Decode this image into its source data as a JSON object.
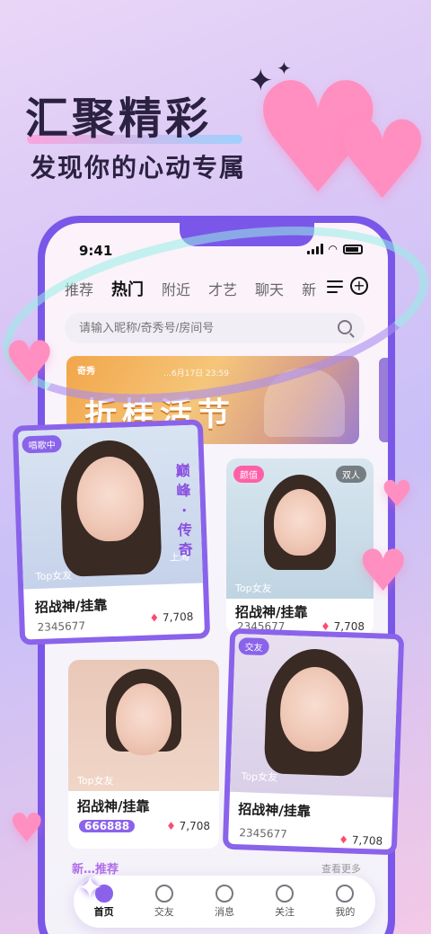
{
  "promo": {
    "title": "汇聚精彩",
    "subtitle": "发现你的心动专属"
  },
  "status_bar": {
    "time": "9:41"
  },
  "tabs": [
    {
      "label": "推荐",
      "active": false
    },
    {
      "label": "热门",
      "active": true
    },
    {
      "label": "附近",
      "active": false
    },
    {
      "label": "才艺",
      "active": false
    },
    {
      "label": "聊天",
      "active": false
    },
    {
      "label": "新",
      "active": false
    }
  ],
  "search": {
    "placeholder": "请输入昵称/奇秀号/房间号"
  },
  "banner": {
    "logo": "奇秀",
    "date": "…6月17日 23:59",
    "title": "折桂活节"
  },
  "cards": [
    {
      "badge": "唱歌中",
      "tag_bottom": "Top女友",
      "location": "上海",
      "side_text": "巅峰·传奇",
      "name": "招战神/挂靠",
      "id": "2345677",
      "heat": "7,708"
    },
    {
      "badge": "颜值",
      "badge_right": "双人",
      "tag_bottom": "Top女友",
      "name": "招战神/挂靠",
      "id": "2345677",
      "heat": "7,708"
    },
    {
      "tag_bottom": "Top女友",
      "name": "招战神/挂靠",
      "id": "666888",
      "heat": "7,708"
    },
    {
      "badge": "交友",
      "tag_bottom": "Top女友",
      "name": "招战神/挂靠",
      "id": "2345677",
      "heat": "7,708"
    }
  ],
  "section": {
    "title": "新…推荐",
    "more": "查看更多"
  },
  "nav": [
    {
      "label": "首页",
      "icon": "home-icon",
      "active": true
    },
    {
      "label": "交友",
      "icon": "chat-bars-icon",
      "active": false
    },
    {
      "label": "消息",
      "icon": "message-icon",
      "active": false
    },
    {
      "label": "关注",
      "icon": "heart-icon",
      "active": false
    },
    {
      "label": "我的",
      "icon": "profile-icon",
      "active": false
    }
  ],
  "colors": {
    "accent": "#8a63ea",
    "heart": "#ff8fc0",
    "banner": "#f2a64a"
  }
}
